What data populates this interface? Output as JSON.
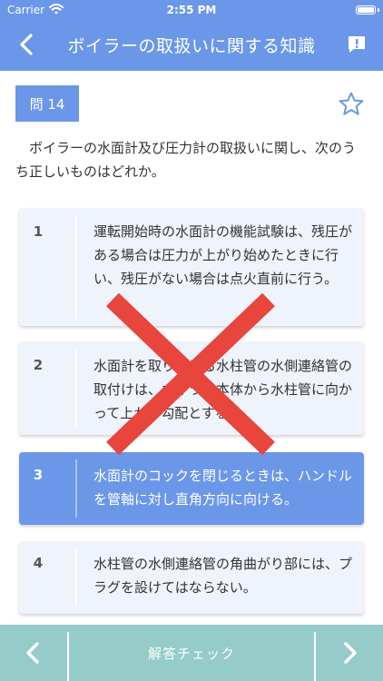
{
  "status_bar": {
    "carrier": "Carrier",
    "time": "2:55 PM"
  },
  "nav": {
    "title": "ボイラーの取扱いに関する知識"
  },
  "question": {
    "number_label": "問 14",
    "text": "ボイラーの水面計及び圧力計の取扱いに関し、次のうち正しいものはどれか。"
  },
  "choices": [
    {
      "number": "1",
      "text": "運転開始時の水面計の機能試験は、残圧がある場合は圧力が上がり始めたときに行い、残圧がない場合は点火直前に行う。"
    },
    {
      "number": "2",
      "text": "水面計を取り付ける水柱管の水側連絡管の取付けは、ボイラー本体から水柱管に向かって上がり勾配とする。"
    },
    {
      "number": "3",
      "text": "水面計のコックを閉じるときは、ハンドルを管軸に対し直角方向に向ける。"
    },
    {
      "number": "4",
      "text": "水柱管の水側連絡管の角曲がり部には、プラグを設けてはならない。"
    }
  ],
  "footer": {
    "check_label": "解答チェック"
  },
  "colors": {
    "accent": "#6b97e8",
    "footer": "#95cbc9",
    "choice_bg": "#eff3fc",
    "cross": "#e8453c"
  },
  "icons": {
    "back": "chevron-left-icon",
    "report": "speech-bubble-exclamation-icon",
    "favorite": "star-outline-icon",
    "wrong_mark": "cross-icon",
    "prev": "chevron-left-icon",
    "next": "chevron-right-icon"
  }
}
